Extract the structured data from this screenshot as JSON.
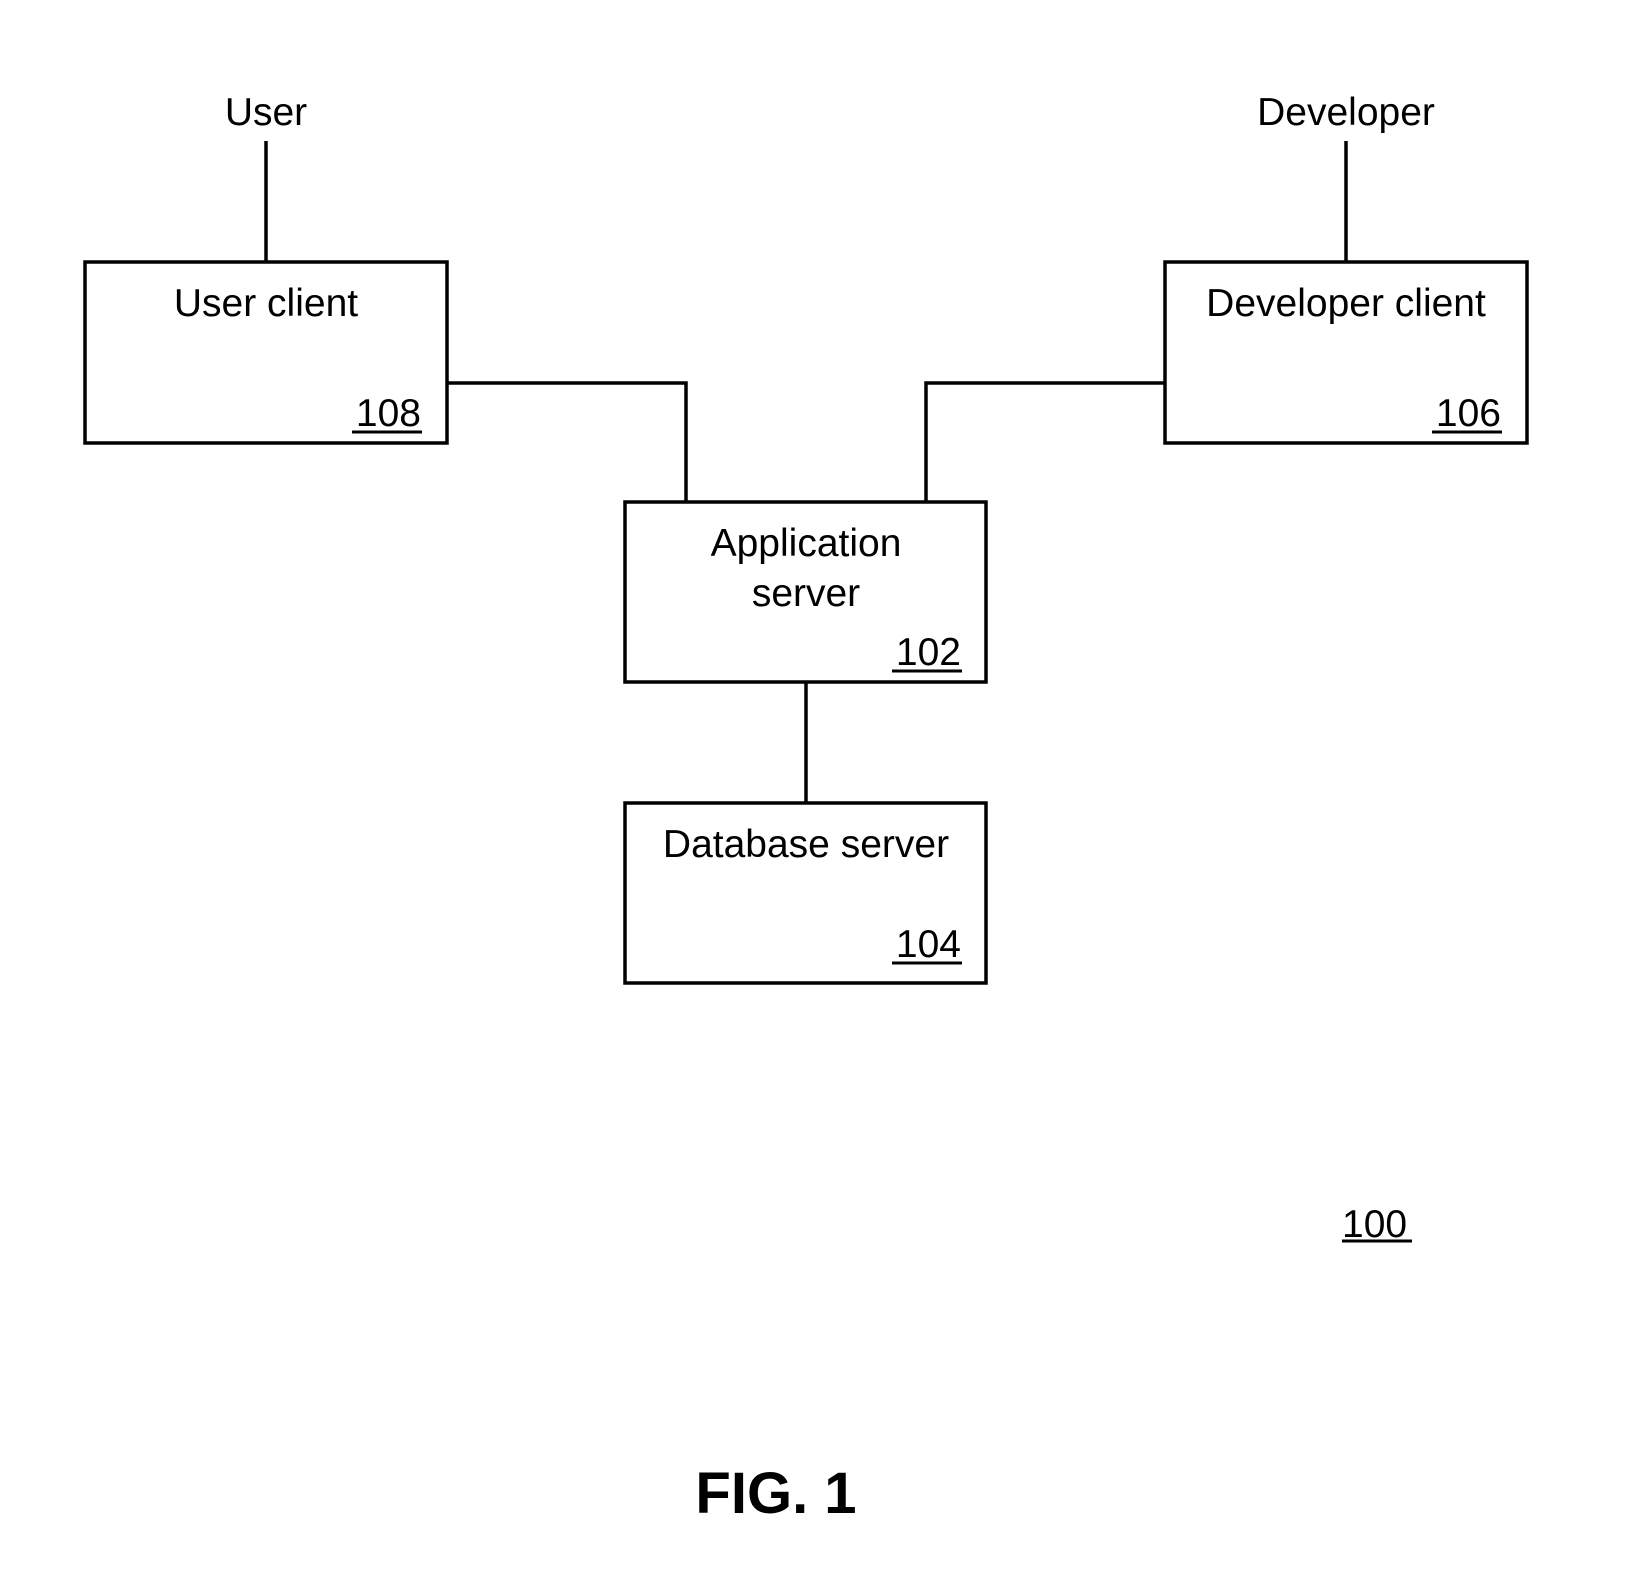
{
  "actors": {
    "user": "User",
    "developer": "Developer"
  },
  "nodes": {
    "user_client": {
      "label": "User client",
      "ref": "108"
    },
    "developer_client": {
      "label": "Developer client",
      "ref": "106"
    },
    "application_server": {
      "label_line1": "Application",
      "label_line2": "server",
      "ref": "102"
    },
    "database_server": {
      "label": "Database server",
      "ref": "104"
    }
  },
  "connections": [
    {
      "from": "User",
      "to": "User client"
    },
    {
      "from": "Developer",
      "to": "Developer client"
    },
    {
      "from": "User client",
      "to": "Application server"
    },
    {
      "from": "Developer client",
      "to": "Application server"
    },
    {
      "from": "Application server",
      "to": "Database server"
    }
  ],
  "system_ref": "100",
  "figure_label": "FIG. 1"
}
